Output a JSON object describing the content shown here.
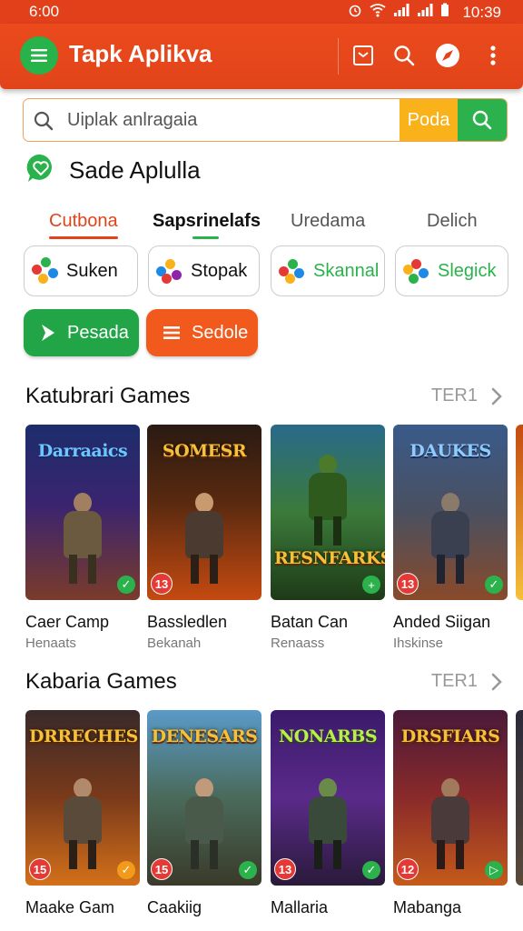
{
  "status_bar": {
    "time_left": "6:00",
    "time_right": "10:39"
  },
  "app_bar": {
    "title": "Tapk Aplikva"
  },
  "search": {
    "placeholder": "Uiplak anlragaia",
    "go_label": "Poda"
  },
  "featured": {
    "label": "Sade Aplulla"
  },
  "tabs": [
    {
      "label": "Cutbona",
      "state": "active"
    },
    {
      "label": "Sapsrinelafs",
      "state": "bold"
    },
    {
      "label": "Uredama",
      "state": "normal"
    },
    {
      "label": "Delich",
      "state": "normal"
    }
  ],
  "chips": [
    {
      "label": "Suken",
      "color": "#111111"
    },
    {
      "label": "Stopak",
      "color": "#111111"
    },
    {
      "label": "Skannal",
      "color": "#2bb24c"
    },
    {
      "label": "Slegick",
      "color": "#2bb24c"
    }
  ],
  "action_buttons": [
    {
      "label": "Pesada",
      "color": "#22a547",
      "icon": "play-arrow-icon"
    },
    {
      "label": "Sedole",
      "color": "#f25a1d",
      "icon": "menu-lines-icon"
    }
  ],
  "sections": [
    {
      "title": "Katubrari Games",
      "more": "TER1",
      "games": [
        {
          "art_title": "Darraaics",
          "name": "Caer Camp",
          "publisher": "Henaats",
          "age": "13",
          "badge": "✓"
        },
        {
          "art_title": "SOMESR",
          "name": "Bassledlen",
          "publisher": "Bekanah",
          "age": "13",
          "badge": ""
        },
        {
          "art_title": "RESNFARKS",
          "name": "Batan Can",
          "publisher": "Renaass",
          "age": "",
          "badge": "+"
        },
        {
          "art_title": "DAUKES",
          "name": "Anded Siigan",
          "publisher": "Ihskinse",
          "age": "13",
          "badge": "✓"
        }
      ]
    },
    {
      "title": "Kabaria Games",
      "more": "TER1",
      "games": [
        {
          "art_title": "DRRECHES",
          "name": "Maake Gam",
          "publisher": "",
          "age": "15",
          "badge": "✓"
        },
        {
          "art_title": "DENESARS",
          "name": "Caakiig",
          "publisher": "",
          "age": "15",
          "badge": "✓"
        },
        {
          "art_title": "NONARBS",
          "name": "Mallaria",
          "publisher": "",
          "age": "13",
          "badge": "✓"
        },
        {
          "art_title": "DRSFIARS",
          "name": "Mabanga",
          "publisher": "",
          "age": "12",
          "badge": "▷"
        }
      ]
    }
  ],
  "colors": {
    "brand": "#e2441a",
    "accent_green": "#2bb24c",
    "accent_yellow": "#f9b21a"
  }
}
